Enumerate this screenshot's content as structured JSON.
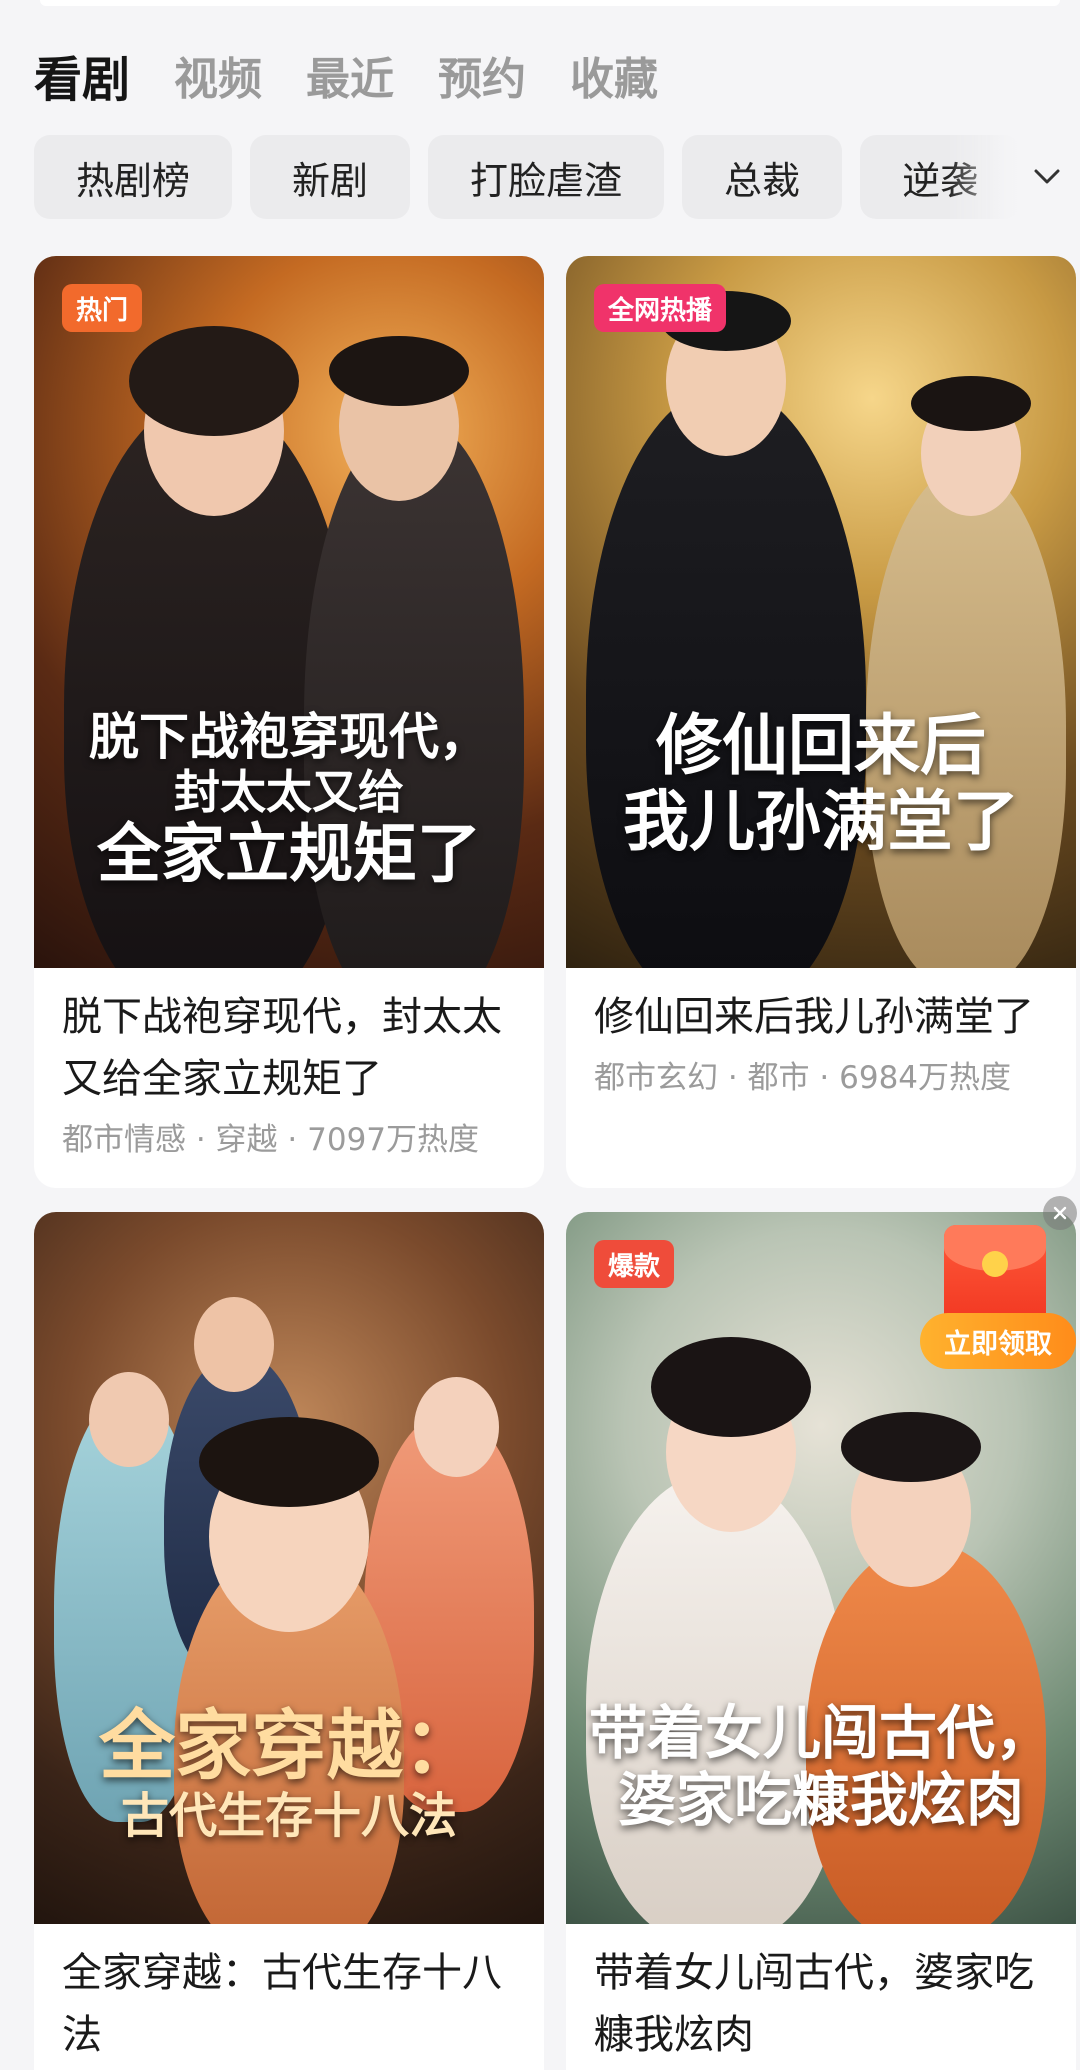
{
  "tabs": [
    "看剧",
    "视频",
    "最近",
    "预约",
    "收藏"
  ],
  "chips": [
    "热剧榜",
    "新剧",
    "打脸虐渣",
    "总裁",
    "逆袭"
  ],
  "icons": {
    "expand": "chevron-down-icon",
    "close": "close-icon",
    "promo": "red-envelope-icon"
  },
  "cards": [
    {
      "badge": "热门",
      "badge_color": "#f26a2c",
      "poster_title": [
        "脱下战袍穿现代，",
        "封太太又给",
        "全家立规矩了"
      ],
      "title": "脱下战袍穿现代，封太太又给全家立规矩了",
      "meta": "都市情感 · 穿越 · 7097万热度"
    },
    {
      "badge": "全网热播",
      "badge_color": "#f0336a",
      "poster_title": [
        "修仙回来后",
        "我儿孙满堂了"
      ],
      "title": "修仙回来后我儿孙满堂了",
      "meta": "都市玄幻 · 都市 · 6984万热度"
    },
    {
      "badge": "",
      "poster_title": [
        "全家穿越：",
        "古代生存十八法"
      ],
      "title": "全家穿越：古代生存十八法",
      "meta": ""
    },
    {
      "badge": "爆款",
      "badge_color": "#ef4c3a",
      "poster_title": [
        "带着女儿闯古代，",
        "婆家吃糠我炫肉"
      ],
      "title": "带着女儿闯古代，婆家吃糠我炫肉",
      "meta": ""
    }
  ],
  "promo": {
    "claim_label": "立即领取"
  }
}
